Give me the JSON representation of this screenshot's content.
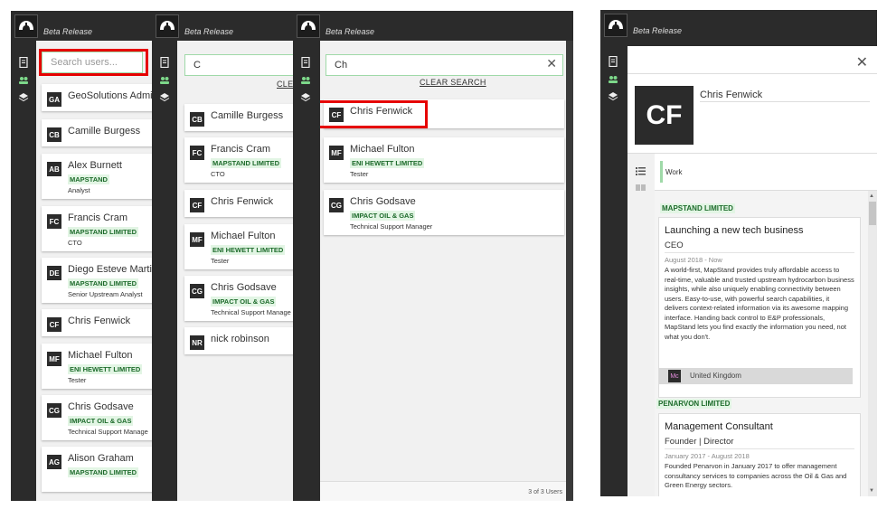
{
  "app": {
    "beta_label": "Beta Release"
  },
  "panel1": {
    "search_placeholder": "Search users...",
    "users": [
      {
        "initials": "GA",
        "name": "GeoSolutions Admi",
        "company": "",
        "role": ""
      },
      {
        "initials": "CB",
        "name": "Camille Burgess",
        "company": "",
        "role": ""
      },
      {
        "initials": "AB",
        "name": "Alex Burnett",
        "company": "MAPSTAND",
        "role": "Analyst"
      },
      {
        "initials": "FC",
        "name": "Francis Cram",
        "company": "MAPSTAND LIMITED",
        "role": "CTO"
      },
      {
        "initials": "DE",
        "name": "Diego Esteve Marti",
        "company": "MAPSTAND LIMITED",
        "role": "Senior Upstream Analyst"
      },
      {
        "initials": "CF",
        "name": "Chris Fenwick",
        "company": "",
        "role": ""
      },
      {
        "initials": "MF",
        "name": "Michael Fulton",
        "company": "ENI HEWETT LIMITED",
        "role": "Tester"
      },
      {
        "initials": "CG",
        "name": "Chris Godsave",
        "company": "IMPACT OIL & GAS",
        "role": "Technical Support Manage"
      },
      {
        "initials": "AG",
        "name": "Alison Graham",
        "company": "MAPSTAND LIMITED",
        "role": ""
      }
    ]
  },
  "panel2": {
    "search_value": "C",
    "clear_label": "CLEA",
    "users": [
      {
        "initials": "CB",
        "name": "Camille Burgess",
        "company": "",
        "role": ""
      },
      {
        "initials": "FC",
        "name": "Francis Cram",
        "company": "MAPSTAND LIMITED",
        "role": "CTO"
      },
      {
        "initials": "CF",
        "name": "Chris Fenwick",
        "company": "",
        "role": ""
      },
      {
        "initials": "MF",
        "name": "Michael Fulton",
        "company": "ENI HEWETT LIMITED",
        "role": "Tester"
      },
      {
        "initials": "CG",
        "name": "Chris Godsave",
        "company": "IMPACT OIL & GAS",
        "role": "Technical Support Manage"
      },
      {
        "initials": "NR",
        "name": "nick robinson",
        "company": "",
        "role": ""
      }
    ]
  },
  "panel3": {
    "search_value": "Ch",
    "clear_label": "CLEAR SEARCH",
    "close_glyph": "✕",
    "users": [
      {
        "initials": "CF",
        "name": "Chris Fenwick",
        "company": "",
        "role": ""
      },
      {
        "initials": "MF",
        "name": "Michael Fulton",
        "company": "ENI HEWETT LIMITED",
        "role": "Tester"
      },
      {
        "initials": "CG",
        "name": "Chris Godsave",
        "company": "IMPACT OIL & GAS",
        "role": "Technical Support Manager"
      }
    ],
    "count_label": "3 of 3 Users"
  },
  "panel4": {
    "close_glyph": "✕",
    "profile": {
      "initials": "CF",
      "name": "Chris Fenwick"
    },
    "tab_label": "Work",
    "companies": [
      {
        "company": "MAPSTAND LIMITED",
        "title": "Launching a new tech business",
        "role": "CEO",
        "dates": "August 2018 - Now",
        "description": "A world-first, MapStand provides truly affordable access to real-time, valuable and trusted upstream hydrocarbon business insights, while also uniquely enabling connectivity between users. Easy-to-use, with powerful search capabilities, it delivers context-related information via its awesome mapping interface. Handing back control to E&P professionals, MapStand lets you find exactly the information you need, not what you don't.",
        "location_badge": "Mc",
        "location": "United Kingdom"
      },
      {
        "company": "PENARVON LIMITED",
        "title": "Management Consultant",
        "role": "Founder | Director",
        "dates": "January 2017 - August 2018",
        "description": "Founded Penarvon in January 2017 to offer management consultancy services to companies across the Oil & Gas and Green Energy sectors."
      }
    ]
  },
  "colors": {
    "accent_green": "#9fd9a8",
    "company_text": "#1d6b2b",
    "highlight_red": "#e60000",
    "dark": "#2b2b2b"
  }
}
